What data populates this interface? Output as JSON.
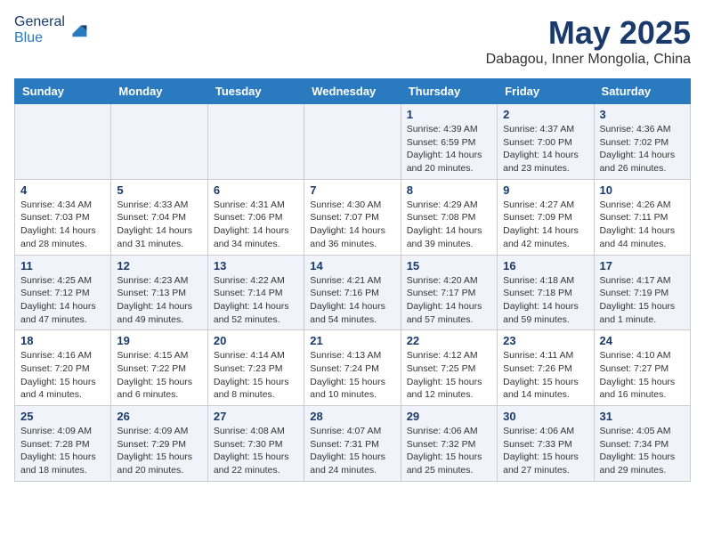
{
  "header": {
    "logo_general": "General",
    "logo_blue": "Blue",
    "month_title": "May 2025",
    "location": "Dabagou, Inner Mongolia, China"
  },
  "days_of_week": [
    "Sunday",
    "Monday",
    "Tuesday",
    "Wednesday",
    "Thursday",
    "Friday",
    "Saturday"
  ],
  "weeks": [
    [
      {
        "day": "",
        "info": ""
      },
      {
        "day": "",
        "info": ""
      },
      {
        "day": "",
        "info": ""
      },
      {
        "day": "",
        "info": ""
      },
      {
        "day": "1",
        "info": "Sunrise: 4:39 AM\nSunset: 6:59 PM\nDaylight: 14 hours\nand 20 minutes."
      },
      {
        "day": "2",
        "info": "Sunrise: 4:37 AM\nSunset: 7:00 PM\nDaylight: 14 hours\nand 23 minutes."
      },
      {
        "day": "3",
        "info": "Sunrise: 4:36 AM\nSunset: 7:02 PM\nDaylight: 14 hours\nand 26 minutes."
      }
    ],
    [
      {
        "day": "4",
        "info": "Sunrise: 4:34 AM\nSunset: 7:03 PM\nDaylight: 14 hours\nand 28 minutes."
      },
      {
        "day": "5",
        "info": "Sunrise: 4:33 AM\nSunset: 7:04 PM\nDaylight: 14 hours\nand 31 minutes."
      },
      {
        "day": "6",
        "info": "Sunrise: 4:31 AM\nSunset: 7:06 PM\nDaylight: 14 hours\nand 34 minutes."
      },
      {
        "day": "7",
        "info": "Sunrise: 4:30 AM\nSunset: 7:07 PM\nDaylight: 14 hours\nand 36 minutes."
      },
      {
        "day": "8",
        "info": "Sunrise: 4:29 AM\nSunset: 7:08 PM\nDaylight: 14 hours\nand 39 minutes."
      },
      {
        "day": "9",
        "info": "Sunrise: 4:27 AM\nSunset: 7:09 PM\nDaylight: 14 hours\nand 42 minutes."
      },
      {
        "day": "10",
        "info": "Sunrise: 4:26 AM\nSunset: 7:11 PM\nDaylight: 14 hours\nand 44 minutes."
      }
    ],
    [
      {
        "day": "11",
        "info": "Sunrise: 4:25 AM\nSunset: 7:12 PM\nDaylight: 14 hours\nand 47 minutes."
      },
      {
        "day": "12",
        "info": "Sunrise: 4:23 AM\nSunset: 7:13 PM\nDaylight: 14 hours\nand 49 minutes."
      },
      {
        "day": "13",
        "info": "Sunrise: 4:22 AM\nSunset: 7:14 PM\nDaylight: 14 hours\nand 52 minutes."
      },
      {
        "day": "14",
        "info": "Sunrise: 4:21 AM\nSunset: 7:16 PM\nDaylight: 14 hours\nand 54 minutes."
      },
      {
        "day": "15",
        "info": "Sunrise: 4:20 AM\nSunset: 7:17 PM\nDaylight: 14 hours\nand 57 minutes."
      },
      {
        "day": "16",
        "info": "Sunrise: 4:18 AM\nSunset: 7:18 PM\nDaylight: 14 hours\nand 59 minutes."
      },
      {
        "day": "17",
        "info": "Sunrise: 4:17 AM\nSunset: 7:19 PM\nDaylight: 15 hours\nand 1 minute."
      }
    ],
    [
      {
        "day": "18",
        "info": "Sunrise: 4:16 AM\nSunset: 7:20 PM\nDaylight: 15 hours\nand 4 minutes."
      },
      {
        "day": "19",
        "info": "Sunrise: 4:15 AM\nSunset: 7:22 PM\nDaylight: 15 hours\nand 6 minutes."
      },
      {
        "day": "20",
        "info": "Sunrise: 4:14 AM\nSunset: 7:23 PM\nDaylight: 15 hours\nand 8 minutes."
      },
      {
        "day": "21",
        "info": "Sunrise: 4:13 AM\nSunset: 7:24 PM\nDaylight: 15 hours\nand 10 minutes."
      },
      {
        "day": "22",
        "info": "Sunrise: 4:12 AM\nSunset: 7:25 PM\nDaylight: 15 hours\nand 12 minutes."
      },
      {
        "day": "23",
        "info": "Sunrise: 4:11 AM\nSunset: 7:26 PM\nDaylight: 15 hours\nand 14 minutes."
      },
      {
        "day": "24",
        "info": "Sunrise: 4:10 AM\nSunset: 7:27 PM\nDaylight: 15 hours\nand 16 minutes."
      }
    ],
    [
      {
        "day": "25",
        "info": "Sunrise: 4:09 AM\nSunset: 7:28 PM\nDaylight: 15 hours\nand 18 minutes."
      },
      {
        "day": "26",
        "info": "Sunrise: 4:09 AM\nSunset: 7:29 PM\nDaylight: 15 hours\nand 20 minutes."
      },
      {
        "day": "27",
        "info": "Sunrise: 4:08 AM\nSunset: 7:30 PM\nDaylight: 15 hours\nand 22 minutes."
      },
      {
        "day": "28",
        "info": "Sunrise: 4:07 AM\nSunset: 7:31 PM\nDaylight: 15 hours\nand 24 minutes."
      },
      {
        "day": "29",
        "info": "Sunrise: 4:06 AM\nSunset: 7:32 PM\nDaylight: 15 hours\nand 25 minutes."
      },
      {
        "day": "30",
        "info": "Sunrise: 4:06 AM\nSunset: 7:33 PM\nDaylight: 15 hours\nand 27 minutes."
      },
      {
        "day": "31",
        "info": "Sunrise: 4:05 AM\nSunset: 7:34 PM\nDaylight: 15 hours\nand 29 minutes."
      }
    ]
  ]
}
